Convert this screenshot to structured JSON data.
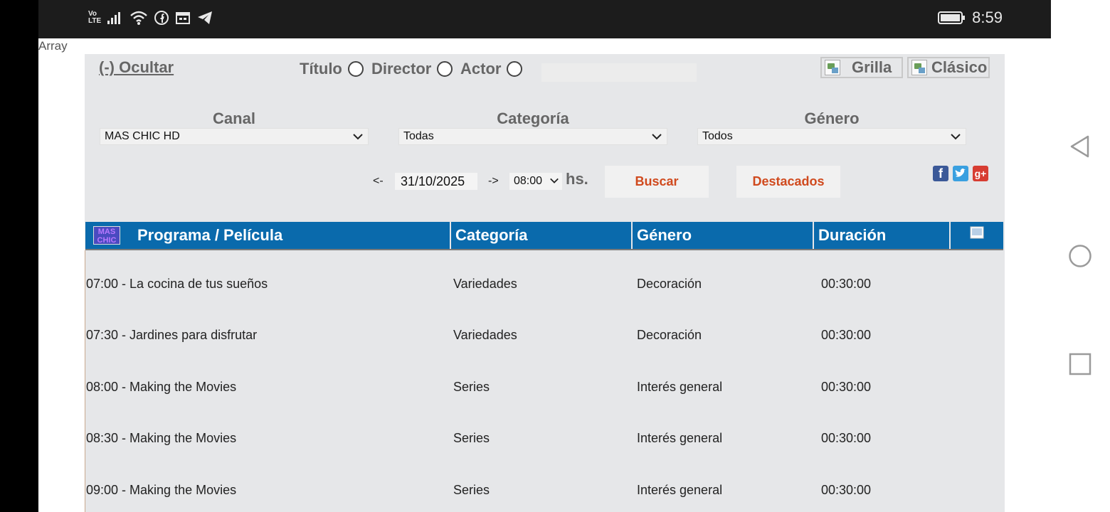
{
  "status": {
    "carrier_top": "Vo",
    "carrier_bottom": "LTE",
    "time": "8:59"
  },
  "array_text": "Array",
  "toggle": {
    "label": "(-) Ocultar"
  },
  "search_by": {
    "titulo": "Título",
    "director": "Director",
    "actor": "Actor",
    "query_value": ""
  },
  "views": {
    "grilla": "Grilla",
    "clasico": "Clásico"
  },
  "filters": {
    "canal": {
      "label": "Canal",
      "value": "MAS CHIC HD"
    },
    "categoria": {
      "label": "Categoría",
      "value": "Todas"
    },
    "genero": {
      "label": "Género",
      "value": "Todos"
    }
  },
  "date_nav": {
    "prev": "<-",
    "date": "31/10/2025",
    "next": "->",
    "time": "08:00",
    "hs": "hs."
  },
  "buttons": {
    "buscar": "Buscar",
    "destacados": "Destacados"
  },
  "channel_logo": {
    "line1": "MAS",
    "line2": "CHIC"
  },
  "table": {
    "headers": [
      "Programa / Película",
      "Categoría",
      "Género",
      "Duración"
    ],
    "rows": [
      {
        "program": "07:00 - La cocina de tus sueños",
        "category": "Variedades",
        "genre": "Decoración",
        "duration": "00:30:00"
      },
      {
        "program": "07:30 - Jardines para disfrutar",
        "category": "Variedades",
        "genre": "Decoración",
        "duration": "00:30:00"
      },
      {
        "program": "08:00 - Making the Movies",
        "category": "Series",
        "genre": "Interés general",
        "duration": "00:30:00"
      },
      {
        "program": "08:30 - Making the Movies",
        "category": "Series",
        "genre": "Interés general",
        "duration": "00:30:00"
      },
      {
        "program": "09:00 - Making the Movies",
        "category": "Series",
        "genre": "Interés general",
        "duration": "00:30:00"
      }
    ]
  },
  "colors": {
    "header_blue": "#0a6aac",
    "panel_bg": "#e6e7e9",
    "accent_orange": "#d04a1e"
  },
  "icons": [
    "signal-icon",
    "wifi-icon",
    "facebook-icon",
    "calendar-icon",
    "telegram-icon",
    "battery-icon",
    "back-icon",
    "home-icon",
    "recents-icon",
    "twitter-icon",
    "google-plus-icon",
    "window-icon"
  ]
}
